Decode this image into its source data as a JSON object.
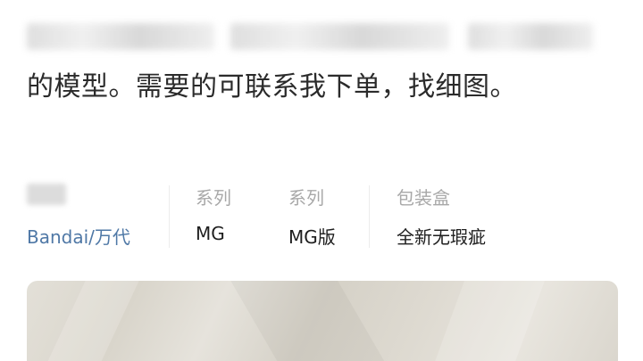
{
  "description": {
    "visible_line": "的模型。需要的可联系我下单，找细图。"
  },
  "attributes": [
    {
      "label": "",
      "value": "Bandai/万代"
    },
    {
      "label": "系列",
      "value": "MG"
    },
    {
      "label": "系列",
      "value": "MG版"
    },
    {
      "label": "包装盒",
      "value": "全新无瑕疵"
    }
  ],
  "colors": {
    "brand_value": "#4f78a6",
    "label": "#a8a8a8",
    "text": "#1e1e1e"
  }
}
